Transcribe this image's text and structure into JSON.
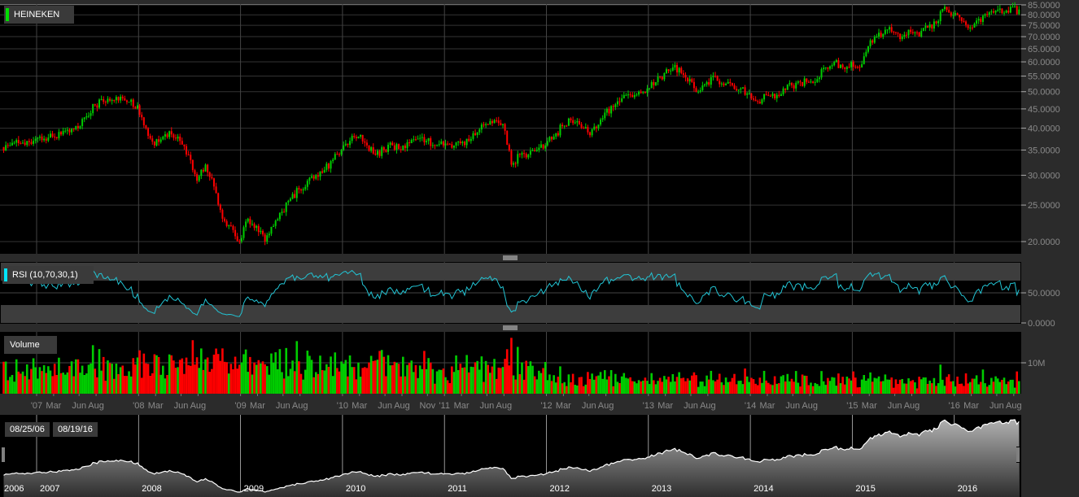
{
  "chart_data": {
    "type": "candlestick",
    "title": "HEINEKEN",
    "start_date": "2006-09",
    "monthly_close": [
      36,
      36.5,
      37,
      37.5,
      37.5,
      38,
      38.5,
      39,
      40,
      43,
      46,
      47,
      47.5,
      48.5,
      47,
      46,
      40,
      36,
      38,
      38.5,
      37,
      34,
      29,
      32,
      28,
      23,
      22,
      20,
      23,
      22,
      20,
      22,
      24,
      26,
      27.5,
      29,
      30,
      31,
      33,
      35,
      37,
      38,
      36,
      34,
      35,
      36,
      35,
      36.5,
      37.5,
      37,
      36,
      36,
      35.5,
      36.5,
      37,
      39,
      41,
      42,
      41,
      32,
      34,
      34,
      35,
      36,
      38,
      40.5,
      42,
      41,
      39,
      40,
      44,
      45.5,
      48,
      49,
      50,
      51,
      53,
      56,
      58,
      56,
      54,
      50,
      53,
      55,
      52,
      52,
      51,
      49.5,
      47,
      49,
      48,
      51,
      52,
      53,
      53,
      54,
      58,
      60,
      58,
      60,
      58,
      66,
      70,
      73,
      72,
      70,
      72,
      70,
      74,
      76,
      84,
      80,
      77,
      74,
      78,
      80,
      82,
      81,
      84,
      80
    ],
    "price_axis": {
      "scale": "log",
      "range": [
        19,
        86
      ],
      "ticks": [
        "85.0000",
        "80.0000",
        "75.0000",
        "70.0000",
        "65.0000",
        "60.0000",
        "55.0000",
        "50.0000",
        "45.0000",
        "40.0000",
        "35.0000",
        "30.0000",
        "25.0000",
        "20.0000"
      ]
    },
    "indicator": {
      "label": "RSI (10,70,30,1)",
      "period": 10,
      "overbought": 70,
      "oversold": 30,
      "range": [
        0,
        100
      ],
      "ticks": [
        "50.0000",
        "0.0000"
      ]
    },
    "volume": {
      "label": "Volume",
      "ticks": [
        "10M"
      ]
    },
    "x_axis_labels": [
      {
        "t": "'07",
        "d": "2007-01"
      },
      {
        "t": "Mar",
        "d": "2007-03"
      },
      {
        "t": "Jun",
        "d": "2007-06"
      },
      {
        "t": "Aug",
        "d": "2007-08"
      },
      {
        "t": "'08",
        "d": "2008-01"
      },
      {
        "t": "Mar",
        "d": "2008-03"
      },
      {
        "t": "Jun",
        "d": "2008-06"
      },
      {
        "t": "Aug",
        "d": "2008-08"
      },
      {
        "t": "'09",
        "d": "2009-01"
      },
      {
        "t": "Mar",
        "d": "2009-03"
      },
      {
        "t": "Jun",
        "d": "2009-06"
      },
      {
        "t": "Aug",
        "d": "2009-08"
      },
      {
        "t": "'10",
        "d": "2010-01"
      },
      {
        "t": "Mar",
        "d": "2010-03"
      },
      {
        "t": "Jun",
        "d": "2010-06"
      },
      {
        "t": "Aug",
        "d": "2010-08"
      },
      {
        "t": "Nov",
        "d": "2010-11"
      },
      {
        "t": "'11",
        "d": "2011-01"
      },
      {
        "t": "Mar",
        "d": "2011-03"
      },
      {
        "t": "Jun",
        "d": "2011-06"
      },
      {
        "t": "Aug",
        "d": "2011-08"
      },
      {
        "t": "'12",
        "d": "2012-01"
      },
      {
        "t": "Mar",
        "d": "2012-03"
      },
      {
        "t": "Jun",
        "d": "2012-06"
      },
      {
        "t": "Aug",
        "d": "2012-08"
      },
      {
        "t": "'13",
        "d": "2013-01"
      },
      {
        "t": "Mar",
        "d": "2013-03"
      },
      {
        "t": "Jun",
        "d": "2013-06"
      },
      {
        "t": "Aug",
        "d": "2013-08"
      },
      {
        "t": "'14",
        "d": "2014-01"
      },
      {
        "t": "Mar",
        "d": "2014-03"
      },
      {
        "t": "Jun",
        "d": "2014-06"
      },
      {
        "t": "Aug",
        "d": "2014-08"
      },
      {
        "t": "'15",
        "d": "2015-01"
      },
      {
        "t": "Mar",
        "d": "2015-03"
      },
      {
        "t": "Jun",
        "d": "2015-06"
      },
      {
        "t": "Aug",
        "d": "2015-08"
      },
      {
        "t": "'16",
        "d": "2016-01"
      },
      {
        "t": "Mar",
        "d": "2016-03"
      },
      {
        "t": "Jun",
        "d": "2016-06"
      },
      {
        "t": "Aug",
        "d": "2016-08"
      }
    ],
    "navigator_years": [
      "2006",
      "2007",
      "2008",
      "2009",
      "2010",
      "2011",
      "2012",
      "2013",
      "2014",
      "2015",
      "2016"
    ],
    "colors": {
      "up": "#00cc00",
      "down": "#ff0000",
      "rsi": "#22c4d4"
    }
  },
  "navigator": {
    "start_date": "08/25/06",
    "end_date": "08/19/16"
  }
}
